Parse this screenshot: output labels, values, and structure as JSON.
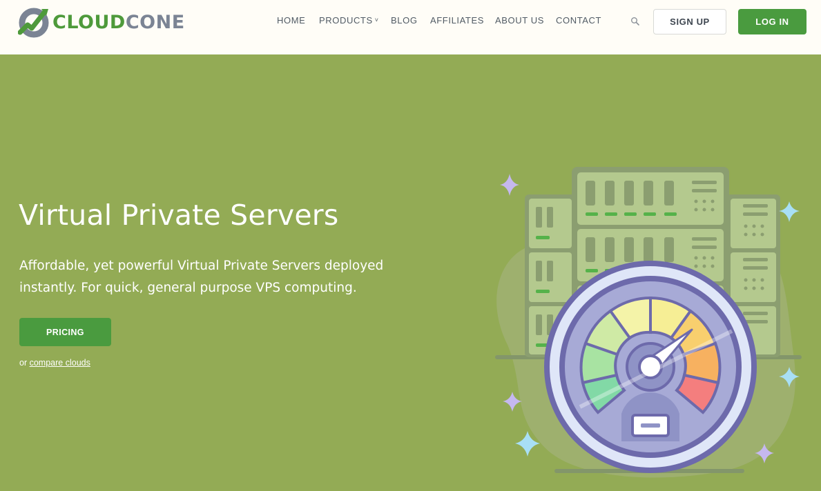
{
  "brand": {
    "name_part1": "CLOUD",
    "name_part2": "CONE",
    "colors": {
      "green": "#4a9b3f",
      "gray": "#7b8494",
      "hero_bg": "#93ab55",
      "header_bg": "#fffdf7"
    }
  },
  "nav": {
    "items": [
      {
        "label": "HOME"
      },
      {
        "label": "PRODUCTS",
        "has_dropdown": true
      },
      {
        "label": "BLOG"
      },
      {
        "label": "AFFILIATES"
      },
      {
        "label": "ABOUT US"
      },
      {
        "label": "CONTACT"
      }
    ],
    "search_icon": "search-icon",
    "signup_label": "SIGN UP",
    "login_label": "LOG IN"
  },
  "hero": {
    "title": "Virtual Private Servers",
    "subtitle": "Affordable, yet powerful Virtual Private Servers deployed instantly. For quick, general purpose VPS computing.",
    "pricing_label": "PRICING",
    "compare_prefix": "or",
    "compare_link": "compare clouds",
    "illustration": "server-speedometer-illustration"
  }
}
